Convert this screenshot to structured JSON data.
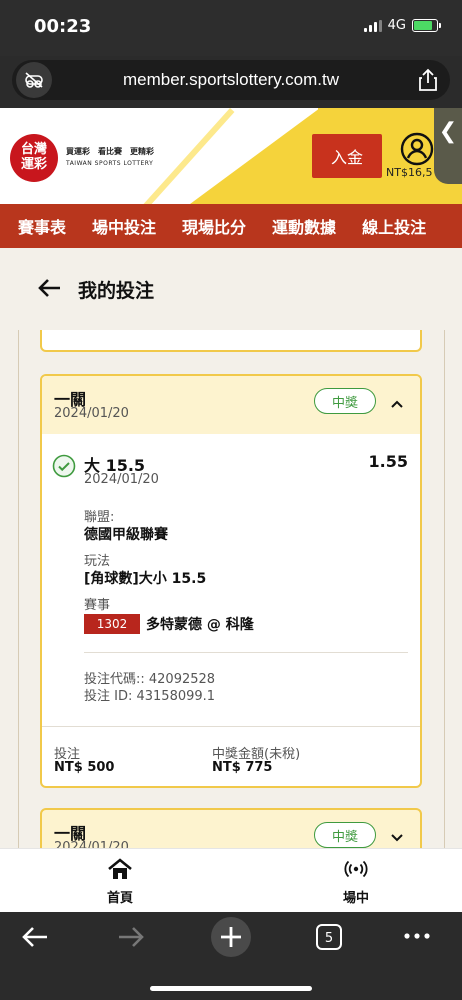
{
  "status": {
    "time": "00:23",
    "network": "4G"
  },
  "browser": {
    "url": "member.sportslottery.com.tw",
    "tabs_count": "5"
  },
  "site": {
    "logo_line1": "台灣",
    "logo_line2": "運彩",
    "slogan": "買運彩　看比賽　更精彩",
    "brand_en": "TAIWAN SPORTS LOTTERY",
    "deposit_label": "入金",
    "balance": "NT$16,5"
  },
  "nav": {
    "items": [
      "賽事表",
      "場中投注",
      "現場比分",
      "運動數據",
      "線上投注"
    ]
  },
  "page": {
    "title": "我的投注"
  },
  "bets": [
    {
      "type": "一關",
      "date": "2024/01/20",
      "status": "中獎",
      "selection": "大 15.5",
      "odds": "1.55",
      "selection_date": "2024/01/20",
      "league_label": "聯盟:",
      "league": "德國甲級聯賽",
      "market_label": "玩法",
      "market": "[角球數]大小 15.5",
      "event_label": "賽事",
      "event_no": "1302",
      "event_name": "多特蒙德 @ 科隆",
      "bet_code": "投注代碼:: 42092528",
      "bet_id": "投注 ID: 43158099.1",
      "stake_label": "投注",
      "stake": "NT$ 500",
      "payout_label": "中獎金額(未稅)",
      "payout": "NT$ 775"
    },
    {
      "type": "一關",
      "date": "2024/01/20",
      "status": "中獎"
    }
  ],
  "tabbar": {
    "home": "首頁",
    "live": "場中"
  },
  "colors": {
    "brand_red": "#b8361d",
    "accent_yellow": "#f5d33b",
    "win_green": "#3f9a3f"
  }
}
